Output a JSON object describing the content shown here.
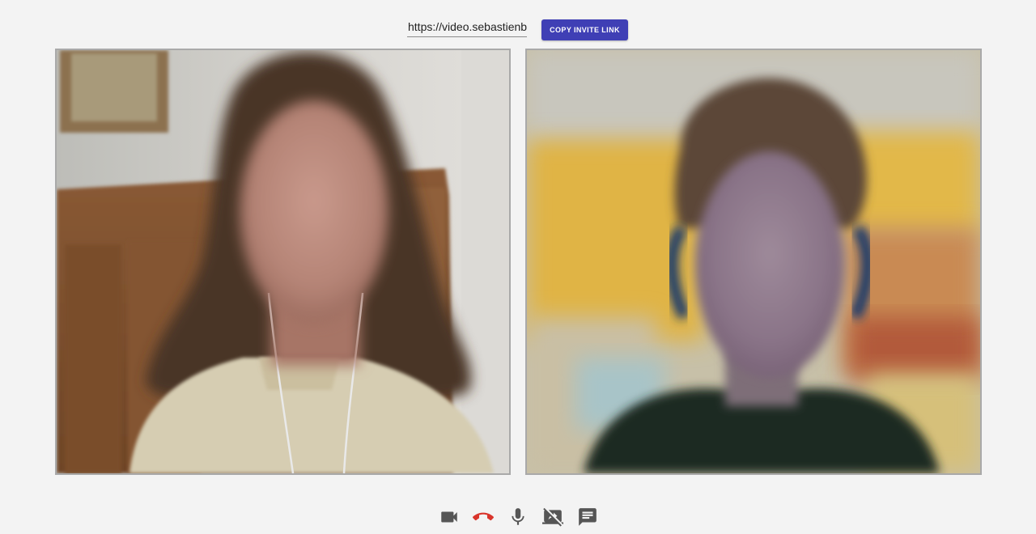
{
  "invite": {
    "url_value": "https://video.sebastienb",
    "copy_button_label": "COPY INVITE LINK"
  },
  "videos": {
    "local": {
      "description_icon": "video-feed"
    },
    "remote": {
      "description_icon": "video-feed"
    }
  },
  "controls": [
    {
      "name": "camera-icon",
      "color": "#555555"
    },
    {
      "name": "hangup-icon",
      "color": "#d9342b"
    },
    {
      "name": "microphone-icon",
      "color": "#555555"
    },
    {
      "name": "screen-share-off-icon",
      "color": "#555555"
    },
    {
      "name": "chat-icon",
      "color": "#555555"
    }
  ],
  "colors": {
    "accent": "#3f3fb5",
    "background": "#f3f3f3",
    "hangup": "#d9342b"
  }
}
